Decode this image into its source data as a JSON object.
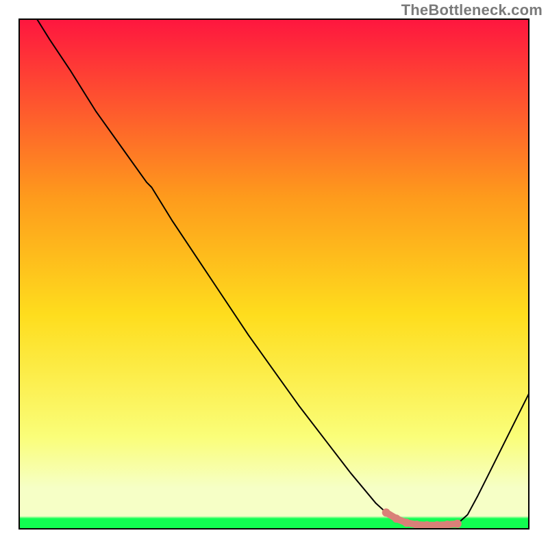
{
  "watermark": "TheBottleneck.com",
  "colors": {
    "gradient_top": "#fe163f",
    "gradient_upper_mid": "#fe9b1c",
    "gradient_mid": "#fedd1d",
    "gradient_lower_mid": "#fafe79",
    "gradient_band": "#f6ffc6",
    "gradient_green": "#11ff51",
    "curve": "#000000",
    "marker": "#d98078",
    "border": "#000000"
  },
  "chart_data": {
    "type": "line",
    "title": "",
    "xlabel": "",
    "ylabel": "",
    "xlim": [
      0,
      100
    ],
    "ylim": [
      0,
      100
    ],
    "grid": false,
    "x": [
      3.5,
      6,
      10,
      15,
      20,
      25,
      26,
      30,
      35,
      40,
      45,
      50,
      55,
      60,
      65,
      70,
      72,
      74,
      76,
      78,
      80,
      82,
      84,
      86,
      88,
      90,
      92,
      94,
      96,
      98,
      100
    ],
    "y": [
      100,
      96,
      90,
      82,
      75,
      68,
      67,
      60.5,
      53,
      45.5,
      38,
      31,
      24,
      17.5,
      11,
      5,
      3.2,
      2.0,
      1.2,
      0.8,
      0.7,
      0.7,
      0.8,
      1.0,
      2.8,
      6.5,
      10.5,
      14.5,
      18.5,
      22.5,
      26.5
    ],
    "markers_x": [
      72,
      74,
      76,
      78,
      80,
      82,
      84,
      86
    ],
    "markers_y": [
      3.2,
      2.0,
      1.2,
      0.8,
      0.7,
      0.7,
      0.8,
      1.0
    ],
    "optimum_x": 81,
    "optimum_y": 0.7
  }
}
